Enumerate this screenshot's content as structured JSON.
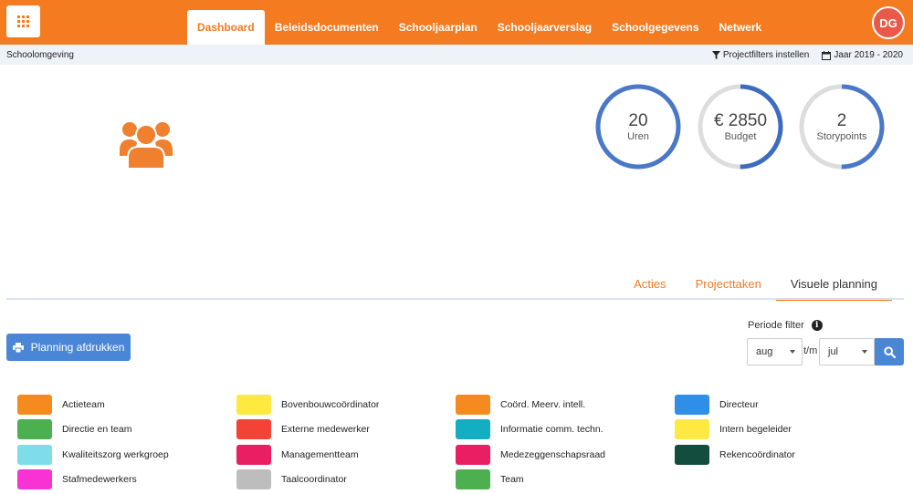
{
  "header": {
    "nav": [
      {
        "label": "Dashboard",
        "active": true
      },
      {
        "label": "Beleidsdocumenten",
        "active": false
      },
      {
        "label": "Schooljaarplan",
        "active": false
      },
      {
        "label": "Schooljaarverslag",
        "active": false
      },
      {
        "label": "Schoolgegevens",
        "active": false
      },
      {
        "label": "Netwerk",
        "active": false
      }
    ],
    "avatar_initials": "DG",
    "brand_color": "#f47b20"
  },
  "subbar": {
    "context": "Schoolomgeving",
    "filter_link": "Projectfilters instellen",
    "year": "Jaar 2019 - 2020"
  },
  "stats": [
    {
      "value": "20",
      "label": "Uren",
      "progress": 1.0
    },
    {
      "value": "€ 2850",
      "label": "Budget",
      "progress": 0.5
    },
    {
      "value": "2",
      "label": "Storypoints",
      "progress": 0.5
    }
  ],
  "tabs": [
    {
      "label": "Acties",
      "active": false
    },
    {
      "label": "Projecttaken",
      "active": false
    },
    {
      "label": "Visuele planning",
      "active": true
    }
  ],
  "toolbar": {
    "print_label": "Planning afdrukken",
    "period_label": "Periode filter",
    "from_value": "aug",
    "separator": "t/m",
    "to_value": "jul"
  },
  "legend": [
    {
      "label": "Actieteam",
      "color": "#f58a1f"
    },
    {
      "label": "Bovenbouwcoördinator",
      "color": "#fde93f"
    },
    {
      "label": "Coörd. Meerv. intell.",
      "color": "#f58a1f"
    },
    {
      "label": "Directeur",
      "color": "#2f8ee6"
    },
    {
      "label": "Directie en team",
      "color": "#4caf50"
    },
    {
      "label": "Externe medewerker",
      "color": "#f44336"
    },
    {
      "label": "Informatie comm. techn.",
      "color": "#14aec2"
    },
    {
      "label": "Intern begeleider",
      "color": "#fde93f"
    },
    {
      "label": "Kwaliteitszorg werkgroep",
      "color": "#7fdde9"
    },
    {
      "label": "Managementteam",
      "color": "#e91e63"
    },
    {
      "label": "Medezeggenschapsraad",
      "color": "#e91e63"
    },
    {
      "label": "Rekencoördinator",
      "color": "#134d3e"
    },
    {
      "label": "Stafmedewerkers",
      "color": "#f832d3"
    },
    {
      "label": "Taalcoordinator",
      "color": "#bdbdbd"
    },
    {
      "label": "Team",
      "color": "#4caf50"
    }
  ]
}
